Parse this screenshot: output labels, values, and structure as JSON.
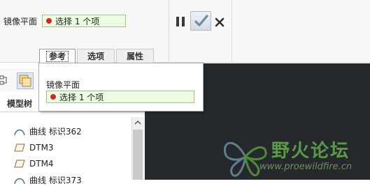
{
  "dashboard": {
    "mirror_plane_label": "镜像平面",
    "collector_text": "选择 1 个项",
    "tabs": [
      {
        "label": "参考",
        "active": true
      },
      {
        "label": "选项",
        "active": false
      },
      {
        "label": "属性",
        "active": false
      }
    ],
    "controls": {
      "pause": "pause-icon",
      "ok": "check-icon",
      "cancel": "close-icon"
    }
  },
  "references_panel": {
    "mirror_plane_label": "镜像平面",
    "collector_text": "选择 1 个项"
  },
  "model_tree": {
    "tab_label": "模型树",
    "items": [
      {
        "label": "曲线 标识362",
        "icon": "curve-icon"
      },
      {
        "label": "DTM3",
        "icon": "datum-plane-icon"
      },
      {
        "label": "DTM4",
        "icon": "datum-plane-icon"
      },
      {
        "label": "曲线 标识373",
        "icon": "curve-icon"
      }
    ]
  },
  "watermark": {
    "title": "野火论坛",
    "url": "www.proewildfire.cn"
  },
  "colors": {
    "collector_bg": "#ecfce3",
    "collector_border": "#9ec48a",
    "status_dot": "#d62626",
    "graphics_bg": "#26292c",
    "logo_green": "#5a9a46"
  }
}
